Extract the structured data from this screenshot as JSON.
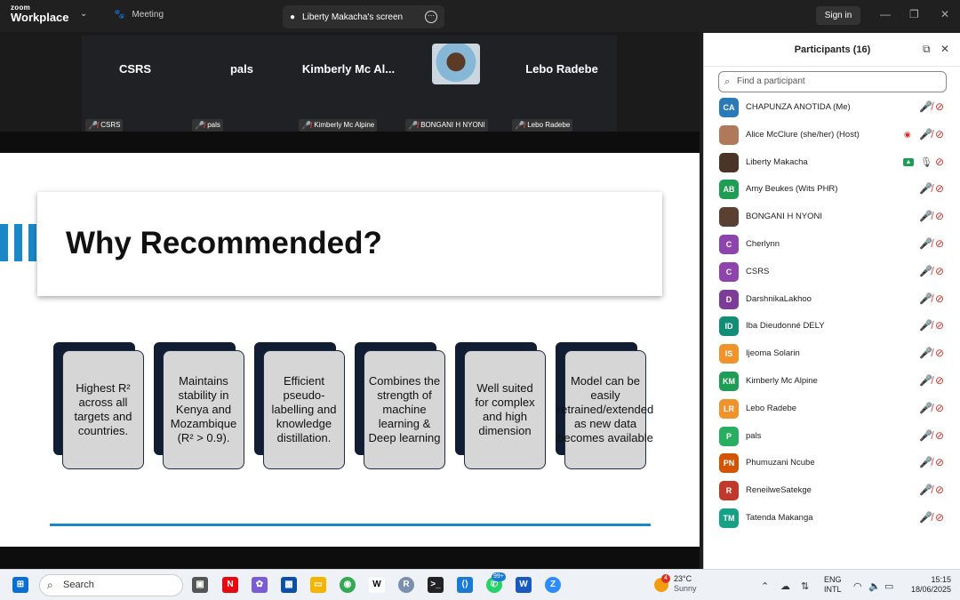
{
  "titlebar": {
    "brand_top": "zoom",
    "brand_bottom": "Workplace",
    "meeting_tab": "Meeting",
    "screen_tab": "Liberty Makacha's screen",
    "sign_in": "Sign in"
  },
  "video_strip": {
    "tiles": [
      {
        "name": "CSRS",
        "label": "CSRS"
      },
      {
        "name": "pals",
        "label": "pals"
      },
      {
        "name": "Kimberly Mc Al...",
        "label": "Kimberly Mc Alpine"
      },
      {
        "name": "",
        "label": "BONGANI H NYONI"
      },
      {
        "name": "Lebo Radebe",
        "label": "Lebo Radebe"
      }
    ]
  },
  "slide": {
    "title": "Why Recommended?",
    "cards": [
      "Highest R² across all targets and countries.",
      "Maintains stability in Kenya and Mozambique (R² > 0.9).",
      "Efficient pseudo-labelling and knowledge distillation.",
      "Combines the strength of machine learning & Deep learning",
      "Well suited for complex and high dimension",
      "Model can be easily retrained/extended as new data becomes available"
    ],
    "accent_color": "#1a87c7"
  },
  "participants": {
    "title": "Participants (16)",
    "search_placeholder": "Find a participant",
    "list": [
      {
        "initials": "CA",
        "name": "CHAPUNZA ANOTIDA (Me)",
        "color": "#2a7ab8"
      },
      {
        "initials": "",
        "name": "Alice McClure (she/her) (Host)",
        "color": "#b07a5a"
      },
      {
        "initials": "",
        "name": "Liberty Makacha",
        "color": "#4a3428"
      },
      {
        "initials": "AB",
        "name": "Amy Beukes (Wits PHR)",
        "color": "#1f9d55"
      },
      {
        "initials": "",
        "name": "BONGANI H NYONI",
        "color": "#5a4030"
      },
      {
        "initials": "C",
        "name": "Cherlynn",
        "color": "#8e44ad"
      },
      {
        "initials": "C",
        "name": "CSRS",
        "color": "#8e44ad"
      },
      {
        "initials": "D",
        "name": "DarshnikaLakhoo",
        "color": "#7d3c98"
      },
      {
        "initials": "ID",
        "name": "Iba Dieudonné DELY",
        "color": "#138d75"
      },
      {
        "initials": "IS",
        "name": "Ijeoma Solarin",
        "color": "#f0932b"
      },
      {
        "initials": "KM",
        "name": "Kimberly Mc Alpine",
        "color": "#1f9d55"
      },
      {
        "initials": "LR",
        "name": "Lebo Radebe",
        "color": "#f0932b"
      },
      {
        "initials": "P",
        "name": "pals",
        "color": "#27ae60"
      },
      {
        "initials": "PN",
        "name": "Phumuzani Ncube",
        "color": "#d35400"
      },
      {
        "initials": "R",
        "name": "ReneilweSatekge",
        "color": "#c0392b"
      },
      {
        "initials": "TM",
        "name": "Tatenda Makanga",
        "color": "#16a085"
      }
    ]
  },
  "taskbar": {
    "search_label": "Search",
    "whatsapp_badge": "99+",
    "weather_badge": "4",
    "temperature": "23°C",
    "condition": "Sunny",
    "lang_top": "ENG",
    "lang_bottom": "INTL",
    "time": "15:15",
    "date": "18/06/2025"
  }
}
